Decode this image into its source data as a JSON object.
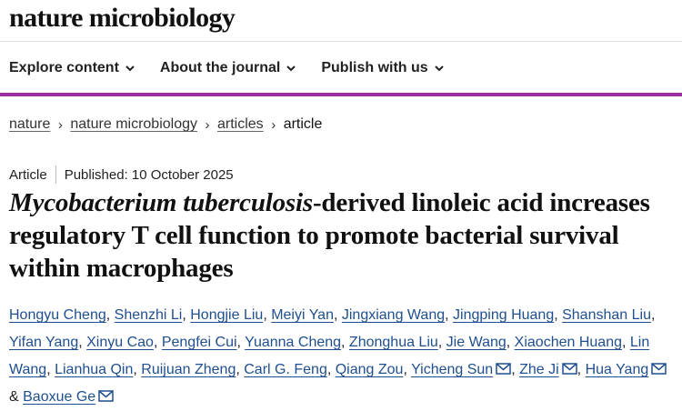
{
  "brand": {
    "name": "nature microbiology"
  },
  "nav": {
    "items": [
      {
        "label": "Explore content"
      },
      {
        "label": "About the journal"
      },
      {
        "label": "Publish with us"
      }
    ]
  },
  "breadcrumb": {
    "items": [
      "nature",
      "nature microbiology",
      "articles"
    ],
    "current": "article"
  },
  "article": {
    "type": "Article",
    "published": "Published: 10 October 2025",
    "title_italic": "Mycobacterium tuberculosis",
    "title_rest": "-derived linoleic acid increases regulatory T cell function to promote bacterial survival within macrophages",
    "authors": [
      "Hongyu Cheng",
      "Shenzhi Li",
      "Hongjie Liu",
      "Meiyi Yan",
      "Jingxiang Wang",
      "Jingping Huang",
      "Shanshan Liu",
      "Yifan Yang",
      "Xinyu Cao",
      "Pengfei Cui",
      "Yuanna Cheng",
      "Zhonghua Liu",
      "Jie Wang",
      "Xiaochen Huang",
      "Lin Wang",
      "Lianhua Qin",
      "Ruijuan Zheng",
      "Carl G. Feng",
      "Qiang Zou",
      "Yicheng Sun",
      "Zhe Ji",
      "Hua Yang",
      "Baoxue Ge"
    ],
    "author_separator": ",",
    "ampersand": "&"
  },
  "colors": {
    "accent_rule": "#9b2f9e",
    "author_link": "#1f4f8f"
  },
  "icons": {
    "nav_dropdown": "chevron-down-icon",
    "corresponding_author": "envelope-icon"
  }
}
